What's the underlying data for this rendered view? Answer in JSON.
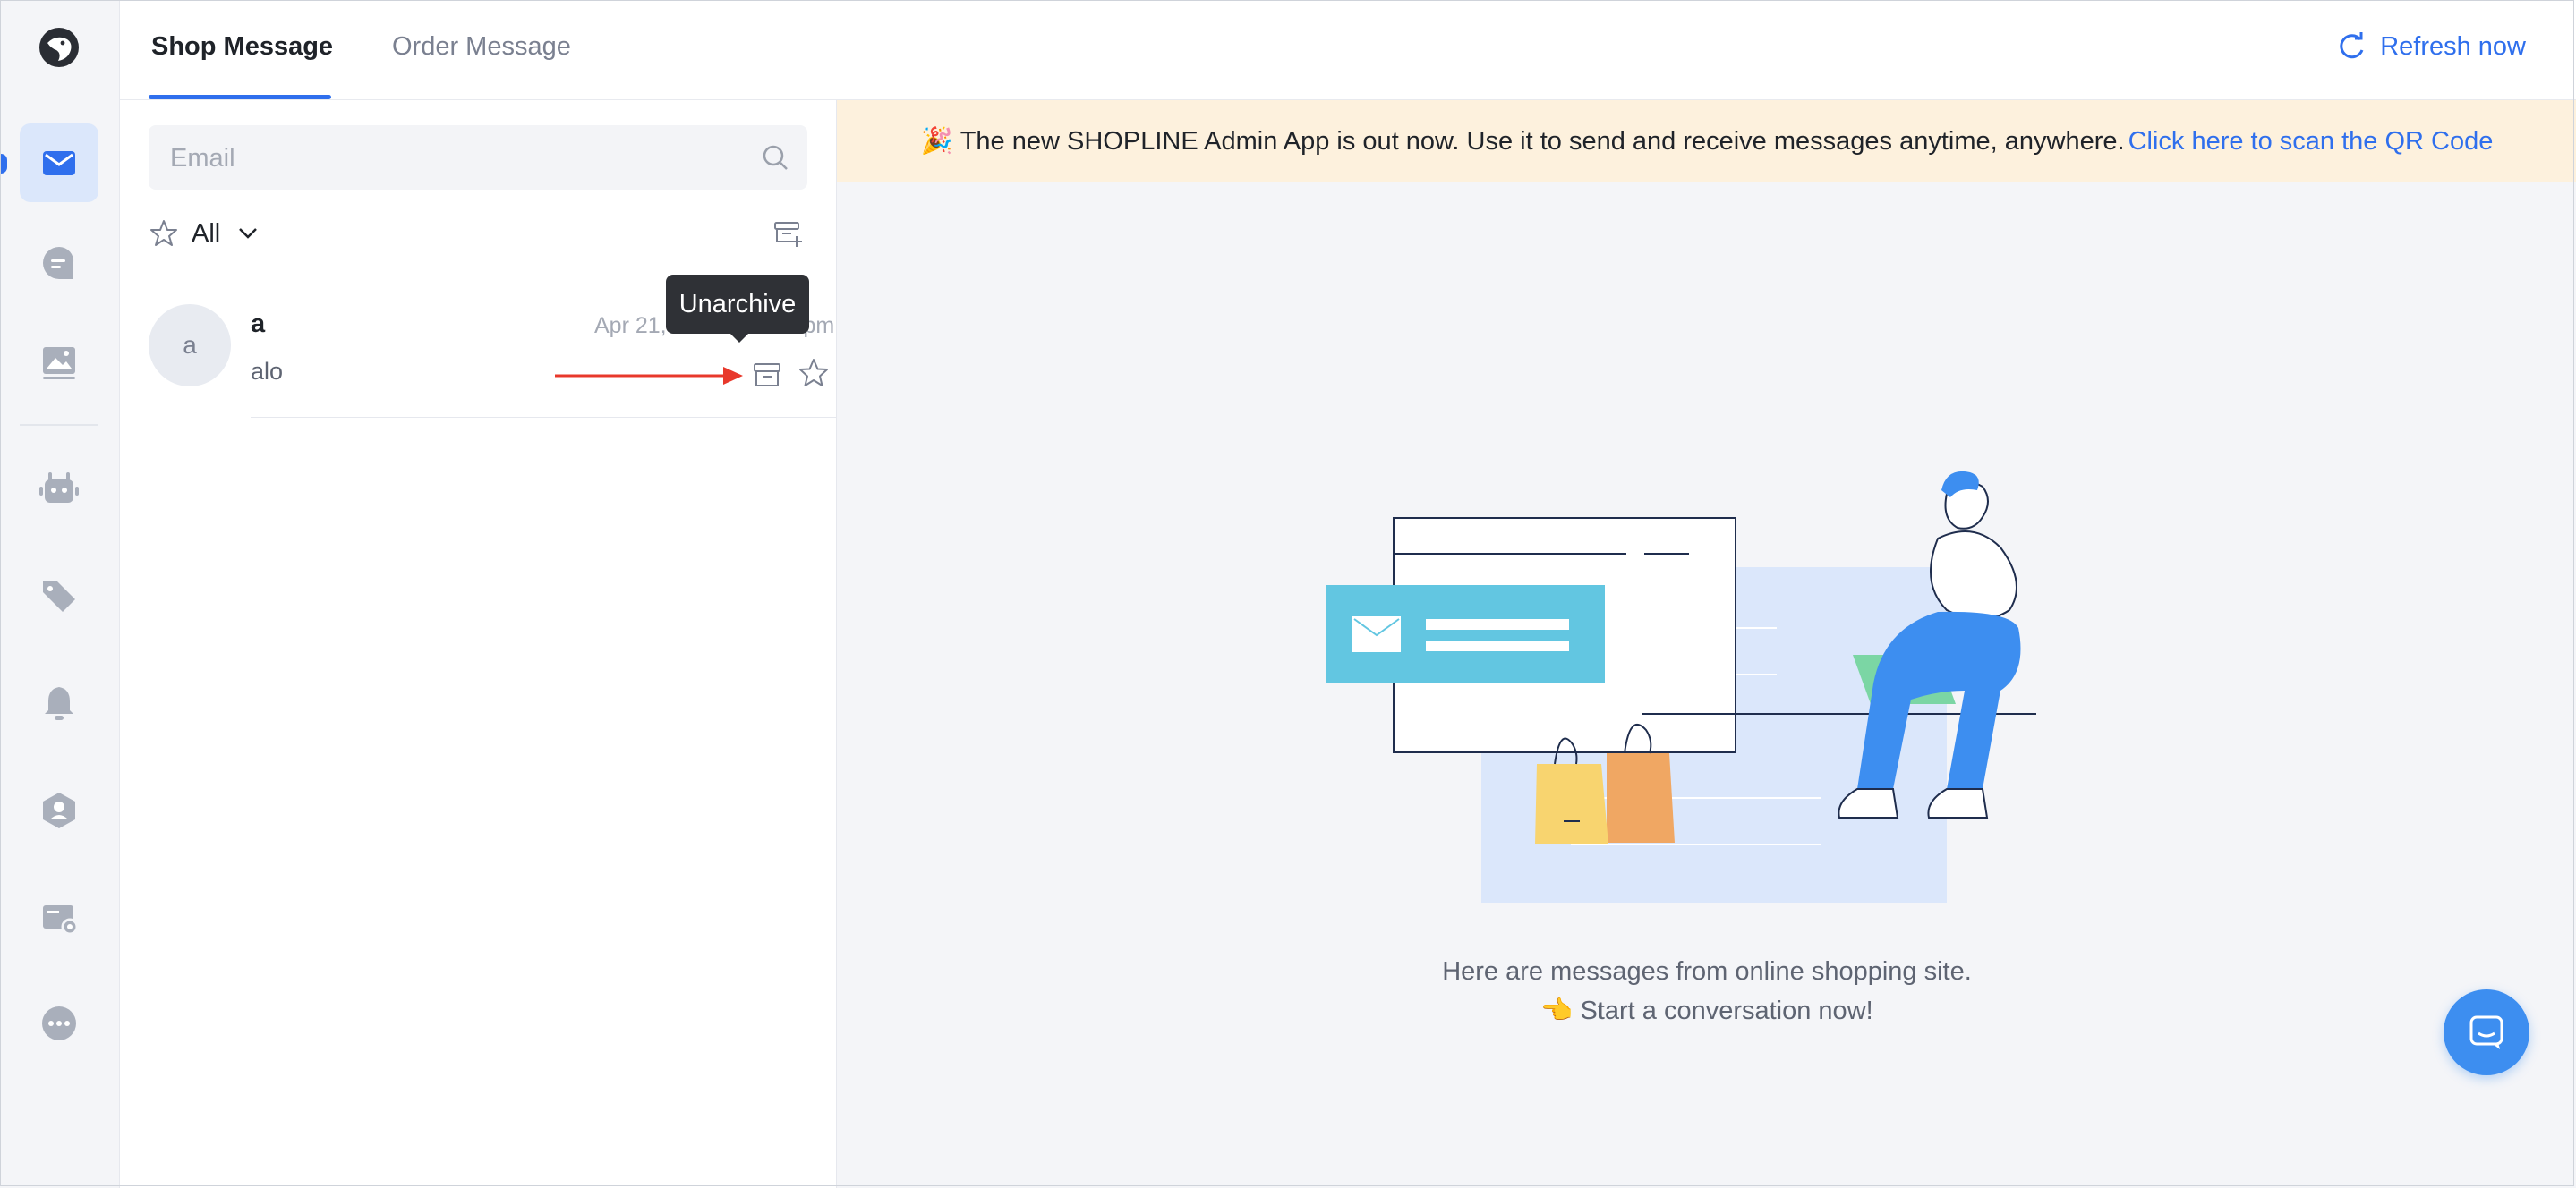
{
  "header": {
    "tabs": [
      {
        "label": "Shop Message",
        "active": true
      },
      {
        "label": "Order Message",
        "active": false
      }
    ],
    "refresh_label": "Refresh now"
  },
  "rail": {
    "icons": [
      "logo-icon",
      "mail-icon",
      "chat-icon",
      "image-icon",
      "robot-icon",
      "tag-icon",
      "bell-icon",
      "contact-icon",
      "settings-card-icon",
      "more-icon"
    ]
  },
  "search": {
    "placeholder": "Email",
    "value": ""
  },
  "filter": {
    "label": "All"
  },
  "conversations": [
    {
      "avatar": "a",
      "name": "a",
      "time": "Apr 21, 2022 at 3:47 pm",
      "preview": "alo"
    }
  ],
  "tooltip": {
    "text": "Unarchive"
  },
  "banner": {
    "emoji": "🎉",
    "text": "The new SHOPLINE Admin App is out now. Use it to send and receive messages anytime, anywhere.",
    "link": "Click here to scan the QR Code"
  },
  "empty_state": {
    "line1": "Here are messages from online shopping site.",
    "line2": "👈 Start a conversation now!"
  },
  "colors": {
    "accent": "#2f6fed",
    "banner_bg": "#fdf1dd",
    "arrow": "#e8382b"
  }
}
